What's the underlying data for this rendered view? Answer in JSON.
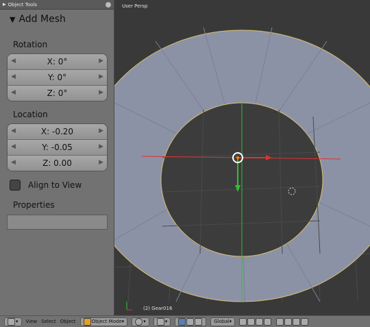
{
  "panel": {
    "header_label": "Object Tools",
    "title": "Add Mesh",
    "rotation_label": "Rotation",
    "rotation": [
      "X: 0°",
      "Y: 0°",
      "Z: 0°"
    ],
    "location_label": "Location",
    "location": [
      "X: -0.20",
      "Y: -0.05",
      "Z: 0.00"
    ],
    "align_label": "Align to View",
    "properties_label": "Properties"
  },
  "viewport": {
    "title": "User Persp",
    "info": "(2) Gear016"
  },
  "bottombar": {
    "view": "View",
    "select": "Select",
    "object": "Object",
    "mode": "Object Mode",
    "orientation": "Global"
  },
  "colors": {
    "panel": "#727272",
    "viewport": "#393939",
    "mesh": "#8a90a0",
    "edge": "#d8c070",
    "axis_x": "#e03030",
    "axis_y": "#30c030"
  }
}
